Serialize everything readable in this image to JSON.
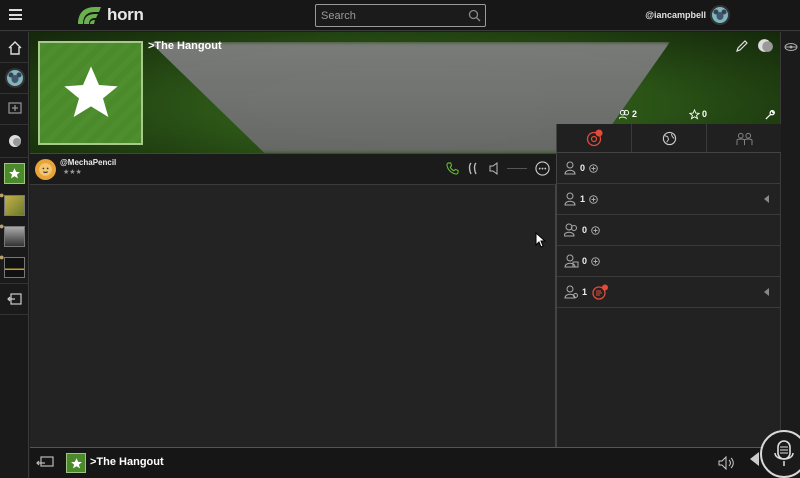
{
  "topbar": {
    "logo_text": "horn",
    "search_placeholder": "Search",
    "username": "@iancampbell"
  },
  "room": {
    "title": ">The Hangout",
    "members_count": "2",
    "stars_count": "0"
  },
  "members": [
    {
      "name": "@MechaPencil",
      "stars": "★★★"
    }
  ],
  "side_panel": {
    "rows": [
      {
        "count": "0"
      },
      {
        "count": "1"
      },
      {
        "count": "0"
      },
      {
        "count": "0"
      },
      {
        "count": "1"
      }
    ]
  },
  "bottombar": {
    "title": ">The Hangout"
  },
  "colors": {
    "accent_green": "#4a8a2a",
    "call_green": "#6bbf3a",
    "alert_red": "#e24a3a"
  },
  "icons": {
    "menu": "hamburger-icon",
    "search": "search-icon",
    "home": "home-icon",
    "edit": "pencil-icon",
    "mic": "microphone-icon"
  }
}
